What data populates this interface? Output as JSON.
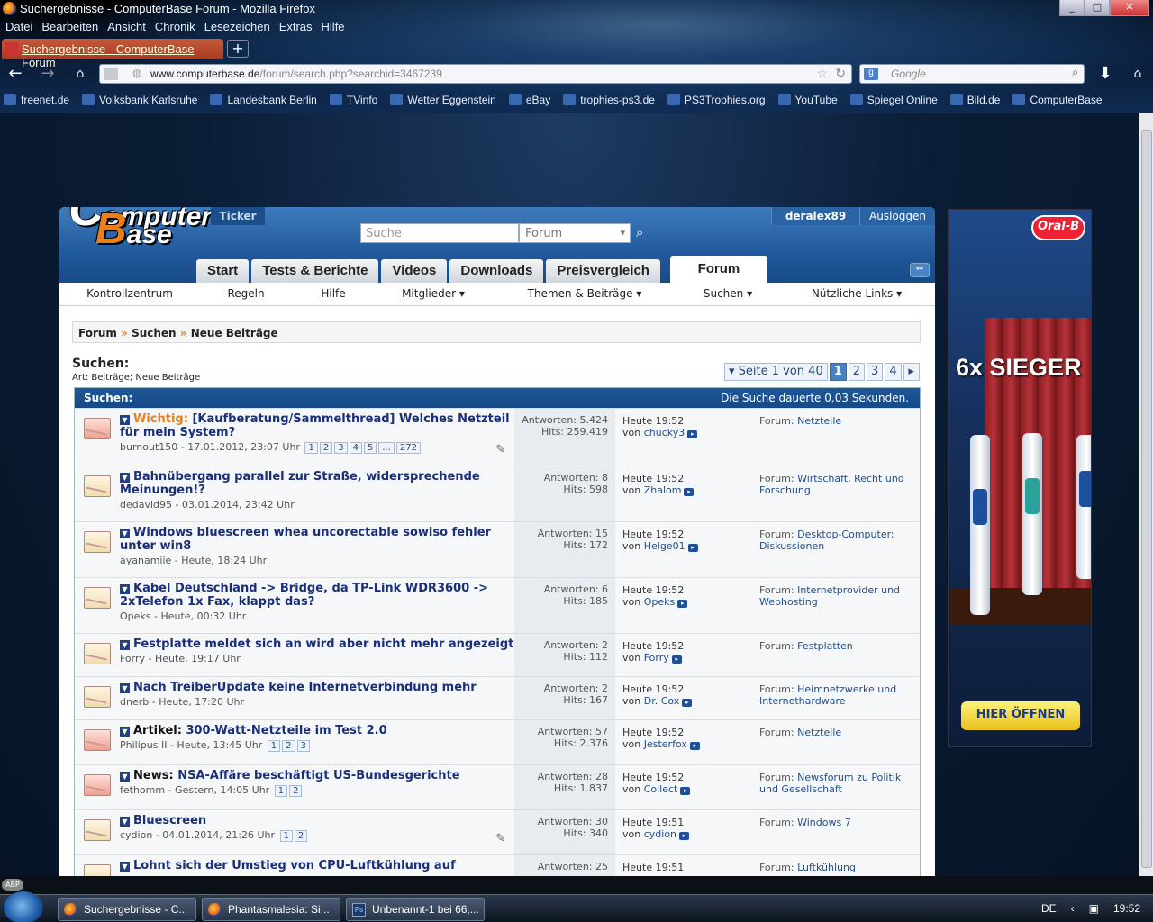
{
  "window": {
    "title": "Suchergebnisse - ComputerBase Forum - Mozilla Firefox",
    "buttons": [
      "_",
      "□",
      "✕"
    ]
  },
  "menu": [
    "Datei",
    "Bearbeiten",
    "Ansicht",
    "Chronik",
    "Lesezeichen",
    "Extras",
    "Hilfe"
  ],
  "browser_tab": {
    "label": "Suchergebnisse - ComputerBase Forum",
    "new_tab": "+"
  },
  "nav": {
    "url_host": "www.computerbase.de",
    "url_path": "/forum/search.php?searchid=3467239",
    "search_placeholder": "Google"
  },
  "bookmarks": [
    "freenet.de",
    "Volksbank Karlsruhe",
    "Landesbank Berlin",
    "TVinfo",
    "Wetter Eggenstein",
    "eBay",
    "trophies-ps3.de",
    "PS3Trophies.org",
    "YouTube",
    "Spiegel Online",
    "Bild.de",
    "ComputerBase"
  ],
  "site": {
    "logo_line1": "omputer",
    "logo_c": "C",
    "logo_line2": "ase",
    "logo_b": "B",
    "ticker": "Ticker",
    "username": "deralex89",
    "logout": "Ausloggen",
    "search_placeholder": "Suche",
    "search_scope": "Forum",
    "tabs": [
      "Start",
      "Tests & Berichte",
      "Videos",
      "Downloads",
      "Preisvergleich",
      "Forum"
    ],
    "active_tab": "Forum",
    "subnav": [
      "Kontrollzentrum",
      "Regeln",
      "Hilfe",
      "Mitglieder ▾",
      "Themen & Beiträge ▾",
      "Suchen ▾",
      "Nützliche Links ▾"
    ],
    "breadcrumb": [
      "Forum",
      "Suchen",
      "Neue Beiträge"
    ],
    "breadcrumb_sep": "»",
    "heading": "Suchen:",
    "subheading": "Art: Beiträge; Neue Beiträge",
    "pager": {
      "label": "▾ Seite 1 von 40",
      "pages": [
        "1",
        "2",
        "3",
        "4"
      ],
      "current": "1",
      "next": "▸"
    },
    "results_header": {
      "title": "Suchen:",
      "timing": "Die Suche dauerte 0,03 Sekunden."
    }
  },
  "results": [
    {
      "prefix": "Wichtig:",
      "prefix_kind": "important",
      "title": "[Kaufberatung/Sammelthread] Welches Netzteil für mein System?",
      "author": "burnout150",
      "date": "17.01.2012, 23:07 Uhr",
      "pages": [
        "1",
        "2",
        "3",
        "4",
        "5",
        "...",
        "272"
      ],
      "replies": "Antworten: 5.424",
      "hits": "Hits: 259.419",
      "last_time": "Heute 19:52",
      "last_by": "von",
      "last_user": "chucky3",
      "forum_prefix": "Forum:",
      "forum": "Netzteile",
      "hot": true,
      "attach": true
    },
    {
      "prefix": "",
      "prefix_kind": "",
      "title": "Bahnübergang parallel zur Straße, widersprechende Meinungen!?",
      "author": "dedavid95",
      "date": "03.01.2014, 23:42 Uhr",
      "pages": [],
      "replies": "Antworten: 8",
      "hits": "Hits: 598",
      "last_time": "Heute 19:52",
      "last_by": "von",
      "last_user": "Zhalom",
      "forum_prefix": "Forum:",
      "forum": "Wirtschaft, Recht und Forschung",
      "hot": false,
      "attach": false
    },
    {
      "prefix": "",
      "prefix_kind": "",
      "title": "Windows bluescreen whea uncorectable sowiso fehler unter win8",
      "author": "ayanamiie",
      "date": "Heute, 18:24 Uhr",
      "pages": [],
      "replies": "Antworten: 15",
      "hits": "Hits: 172",
      "last_time": "Heute 19:52",
      "last_by": "von",
      "last_user": "Helge01",
      "forum_prefix": "Forum:",
      "forum": "Desktop-Computer: Diskussionen",
      "hot": false,
      "attach": false
    },
    {
      "prefix": "",
      "prefix_kind": "",
      "title": "Kabel Deutschland -> Bridge, da TP-Link WDR3600 -> 2xTelefon 1x Fax, klappt das?",
      "author": "Opeks",
      "date": "Heute, 00:32 Uhr",
      "pages": [],
      "replies": "Antworten: 6",
      "hits": "Hits: 185",
      "last_time": "Heute 19:52",
      "last_by": "von",
      "last_user": "Opeks",
      "forum_prefix": "Forum:",
      "forum": "Internetprovider und Webhosting",
      "hot": false,
      "attach": false
    },
    {
      "prefix": "",
      "prefix_kind": "",
      "title": "Festplatte meldet sich an wird aber nicht mehr angezeigt",
      "author": "Forry",
      "date": "Heute, 19:17 Uhr",
      "pages": [],
      "replies": "Antworten: 2",
      "hits": "Hits: 112",
      "last_time": "Heute 19:52",
      "last_by": "von",
      "last_user": "Forry",
      "forum_prefix": "Forum:",
      "forum": "Festplatten",
      "hot": false,
      "attach": false
    },
    {
      "prefix": "",
      "prefix_kind": "",
      "title": "Nach TreiberUpdate keine Internetverbindung mehr",
      "author": "dnerb",
      "date": "Heute, 17:20 Uhr",
      "pages": [],
      "replies": "Antworten: 2",
      "hits": "Hits: 167",
      "last_time": "Heute 19:52",
      "last_by": "von",
      "last_user": "Dr. Cox",
      "forum_prefix": "Forum:",
      "forum": "Heimnetzwerke und Internethardware",
      "hot": false,
      "attach": false
    },
    {
      "prefix": "Artikel:",
      "prefix_kind": "plain",
      "title": "300-Watt-Netzteile im Test 2.0",
      "author": "Philipus II",
      "date": "Heute, 13:45 Uhr",
      "pages": [
        "1",
        "2",
        "3"
      ],
      "replies": "Antworten: 57",
      "hits": "Hits: 2.376",
      "last_time": "Heute 19:52",
      "last_by": "von",
      "last_user": "Jesterfox",
      "forum_prefix": "Forum:",
      "forum": "Netzteile",
      "hot": true,
      "attach": false
    },
    {
      "prefix": "News:",
      "prefix_kind": "plain",
      "title": "NSA-Affäre beschäftigt US-Bundesgerichte",
      "author": "fethomm",
      "date": "Gestern, 14:05 Uhr",
      "pages": [
        "1",
        "2"
      ],
      "replies": "Antworten: 28",
      "hits": "Hits: 1.837",
      "last_time": "Heute 19:52",
      "last_by": "von",
      "last_user": "Collect",
      "forum_prefix": "Forum:",
      "forum": "Newsforum zu Politik und Gesellschaft",
      "hot": true,
      "attach": false
    },
    {
      "prefix": "",
      "prefix_kind": "",
      "title": "Bluescreen",
      "author": "cydion",
      "date": "04.01.2014, 21:26 Uhr",
      "pages": [
        "1",
        "2"
      ],
      "replies": "Antworten: 30",
      "hits": "Hits: 340",
      "last_time": "Heute 19:51",
      "last_by": "von",
      "last_user": "cydion",
      "forum_prefix": "Forum:",
      "forum": "Windows 7",
      "hot": false,
      "attach": true
    },
    {
      "prefix": "",
      "prefix_kind": "",
      "title": "Lohnt sich der Umstieg von CPU-Luftkühlung auf",
      "author": "",
      "date": "",
      "pages": [],
      "replies": "Antworten: 25",
      "hits": "",
      "last_time": "Heute 19:51",
      "last_by": "",
      "last_user": "",
      "forum_prefix": "Forum:",
      "forum": "Luftkühlung",
      "hot": false,
      "attach": false
    }
  ],
  "ad": {
    "brand": "Oral-B",
    "headline": "6x SIEGER",
    "cta": "HIER ÖFFNEN"
  },
  "taskbar": {
    "tasks": [
      "Suchergebnisse - C...",
      "Phantasmalesia: Si...",
      "Unbenannt-1 bei 66,..."
    ],
    "lang": "DE",
    "time": "19:52"
  },
  "status": {
    "abp": "ABP"
  },
  "colors": {
    "accent": "#e87e1c",
    "header_blue": "#1d5597",
    "link": "#1a2f7a"
  }
}
